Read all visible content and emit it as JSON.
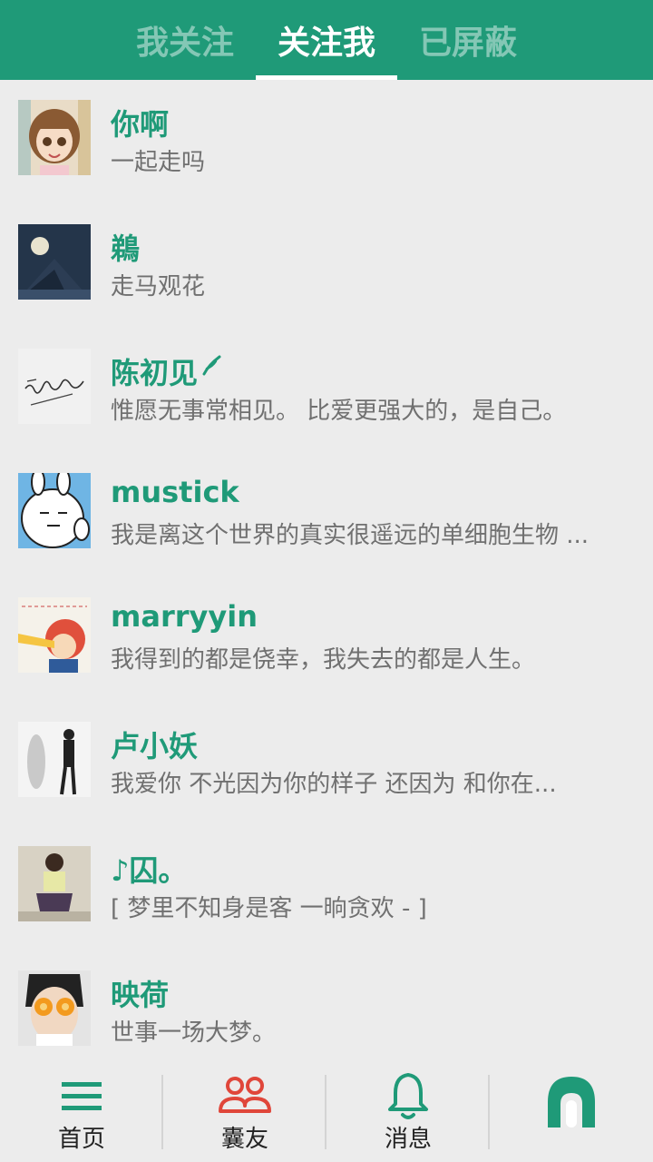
{
  "tabs": [
    {
      "label": "我关注",
      "active": false
    },
    {
      "label": "关注我",
      "active": true
    },
    {
      "label": "已屏蔽",
      "active": false
    }
  ],
  "colors": {
    "accent": "#1f9a78",
    "active_nav": "#e0463a"
  },
  "users": [
    {
      "name": "你啊",
      "signature": "一起走吗",
      "avatar": "anime-girl-avatar"
    },
    {
      "name": "鵜",
      "signature": "走马观花",
      "avatar": "night-moon-avatar"
    },
    {
      "name": "陈初见",
      "signature": "惟愿无事常相见。 比爱更强大的，是自己。",
      "avatar": "calligraphy-avatar",
      "verified": true
    },
    {
      "name": "mustick",
      "signature": "我是离这个世界的真实很遥远的单细胞生物 ...",
      "avatar": "rabbit-avatar"
    },
    {
      "name": "marryyin",
      "signature": "我得到的都是侥幸，我失去的都是人生。",
      "avatar": "cartoon-boy-avatar"
    },
    {
      "name": "卢小妖",
      "signature": "我爱你  不光因为你的样子  还因为  和你在...",
      "avatar": "silhouette-avatar"
    },
    {
      "name": "♪囚。",
      "signature": "[ 梦里不知身是客 一晌贪欢 - ]",
      "avatar": "person-sitting-avatar"
    },
    {
      "name": "映荷",
      "signature": "世事一场大梦。",
      "avatar": "orange-eyes-avatar"
    }
  ],
  "nav": [
    {
      "label": "首页",
      "icon": "menu-icon"
    },
    {
      "label": "囊友",
      "icon": "friends-icon"
    },
    {
      "label": "消息",
      "icon": "bell-icon"
    },
    {
      "label": "",
      "icon": "profile-icon"
    }
  ]
}
